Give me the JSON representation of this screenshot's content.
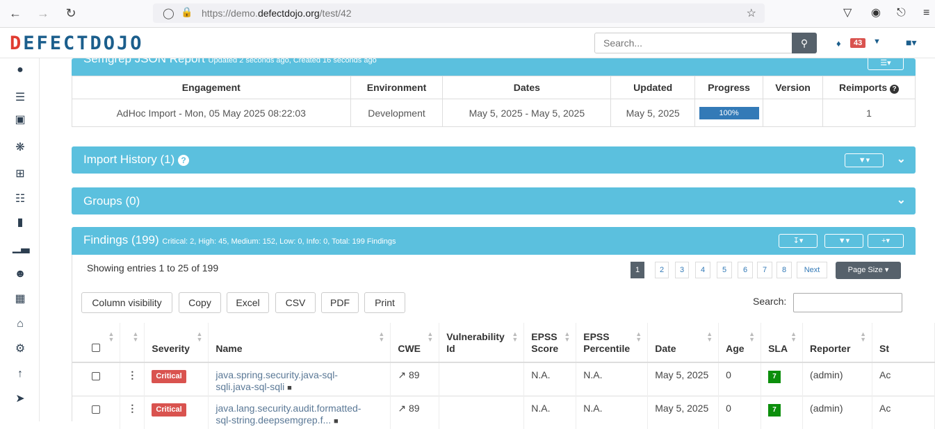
{
  "browser": {
    "url_prefix": "https://demo.",
    "url_domain": "defectdojo.org",
    "url_path": "/test/42",
    "back_icon": "arrow-left-icon",
    "forward_icon": "arrow-right-icon",
    "reload_icon": "reload-icon"
  },
  "header": {
    "logo_red": "D",
    "logo_rest": "EFECTDOJO",
    "search_placeholder": "Search...",
    "alert_count": "43"
  },
  "test_panel": {
    "title": "Semgrep JSON Report",
    "subtitle": "Updated 2 seconds ago, Created 16 seconds ago",
    "columns": [
      "Engagement",
      "Environment",
      "Dates",
      "Updated",
      "Progress",
      "Version",
      "Reimports"
    ],
    "row": {
      "engagement": "AdHoc Import - Mon, 05 May 2025 08:22:03",
      "environment": "Development",
      "dates": "May 5, 2025 - May 5, 2025",
      "updated": "May 5, 2025",
      "progress": "100%",
      "progress_fraction": 1.0,
      "version": "",
      "reimports": "1"
    }
  },
  "import_history": {
    "title": "Import History (1)"
  },
  "groups": {
    "title": "Groups (0)"
  },
  "findings": {
    "title": "Findings (199)",
    "summary": "Critical: 2, High: 45, Medium: 152, Low: 0, Info: 0, Total: 199 Findings",
    "showing": "Showing entries 1 to 25 of 199",
    "pages": [
      "1",
      "2",
      "3",
      "4",
      "5",
      "6",
      "7",
      "8",
      "Next"
    ],
    "page_size_label": "Page Size",
    "buttons": [
      "Column visibility",
      "Copy",
      "Excel",
      "CSV",
      "PDF",
      "Print"
    ],
    "search_label": "Search:",
    "columns": [
      "Severity",
      "Name",
      "CWE",
      "Vulnerability Id",
      "EPSS Score",
      "EPSS Percentile",
      "Date",
      "Age",
      "SLA",
      "Reporter",
      "Status"
    ],
    "columns_display": [
      "Severity",
      "Name",
      "CWE",
      "Vulnerability\nId",
      "EPSS\nScore",
      "EPSS\nPercentile",
      "Date",
      "Age",
      "SLA",
      "Reporter",
      "St"
    ],
    "rows": [
      {
        "severity": "Critical",
        "name_line1": "java.spring.security.java-sql-",
        "name_line2": "sqli.java-sql-sqli",
        "cwe": "89",
        "vuln_id": "",
        "epss_score": "N.A.",
        "epss_percentile": "N.A.",
        "date": "May 5, 2025",
        "age": "0",
        "sla": "7",
        "reporter": "(admin)",
        "status": "Ac"
      },
      {
        "severity": "Critical",
        "name_line1": "java.lang.security.audit.formatted-",
        "name_line2": "sql-string.deepsemgrep.f...",
        "cwe": "89",
        "vuln_id": "",
        "epss_score": "N.A.",
        "epss_percentile": "N.A.",
        "date": "May 5, 2025",
        "age": "0",
        "sla": "7",
        "reporter": "(admin)",
        "status": "Ac"
      }
    ]
  },
  "sidebar_icons": [
    "dashboard-icon",
    "list-icon",
    "inbox-icon",
    "bug-icon",
    "table-icon",
    "sitemap-icon",
    "file-icon",
    "chart-icon",
    "user-icon",
    "calendar-icon",
    "house-icon",
    "cog-icon",
    "upload-icon",
    "circle-arrow-icon"
  ],
  "colors": {
    "panel": "#5bc0de",
    "critical": "#d9534f",
    "sla_ok": "#0c8f0c",
    "progress": "#337ab7",
    "brand": "#1b5e8c"
  }
}
